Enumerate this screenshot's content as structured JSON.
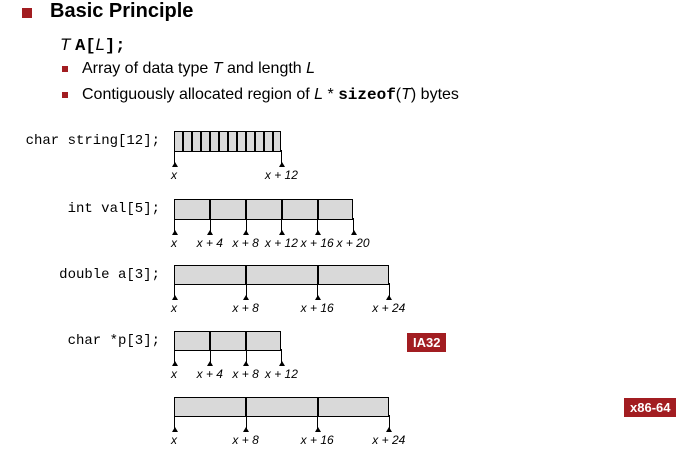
{
  "header": {
    "title": "Basic Principle",
    "decl_type": "T",
    "decl_name": "A[",
    "decl_len": "L",
    "decl_end": "];",
    "bullet1_prefix": "Array of data type ",
    "bullet1_T": "T",
    "bullet1_mid": " and length ",
    "bullet1_L": "L",
    "bullet2_prefix": "Contiguously allocated region of ",
    "bullet2_L": "L",
    "bullet2_star": " * ",
    "bullet2_sizeof": "sizeof",
    "bullet2_paren_open": "(",
    "bullet2_T": "T",
    "bullet2_paren_close": ")",
    "bullet2_suffix": " bytes"
  },
  "diagrams": [
    {
      "decl": "char string[12];",
      "elements": 12,
      "labels": [
        "x",
        "x + 12"
      ]
    },
    {
      "decl": "int val[5];",
      "elements": 5,
      "labels": [
        "x",
        "x + 4",
        "x + 8",
        "x + 12",
        "x + 16",
        "x + 20"
      ]
    },
    {
      "decl": "double a[3];",
      "elements": 3,
      "labels": [
        "x",
        "x + 8",
        "x + 16",
        "x + 24"
      ]
    },
    {
      "decl": "char *p[3];",
      "elements": 3,
      "labels": [
        "x",
        "x + 4",
        "x + 8",
        "x + 12"
      ],
      "tag": "IA32"
    },
    {
      "decl": "",
      "elements": 3,
      "labels": [
        "x",
        "x + 8",
        "x + 16",
        "x + 24"
      ],
      "tag": "x86-64"
    }
  ],
  "colors": {
    "accent": "#a21d21",
    "cell_fill": "#d9d9d9"
  }
}
